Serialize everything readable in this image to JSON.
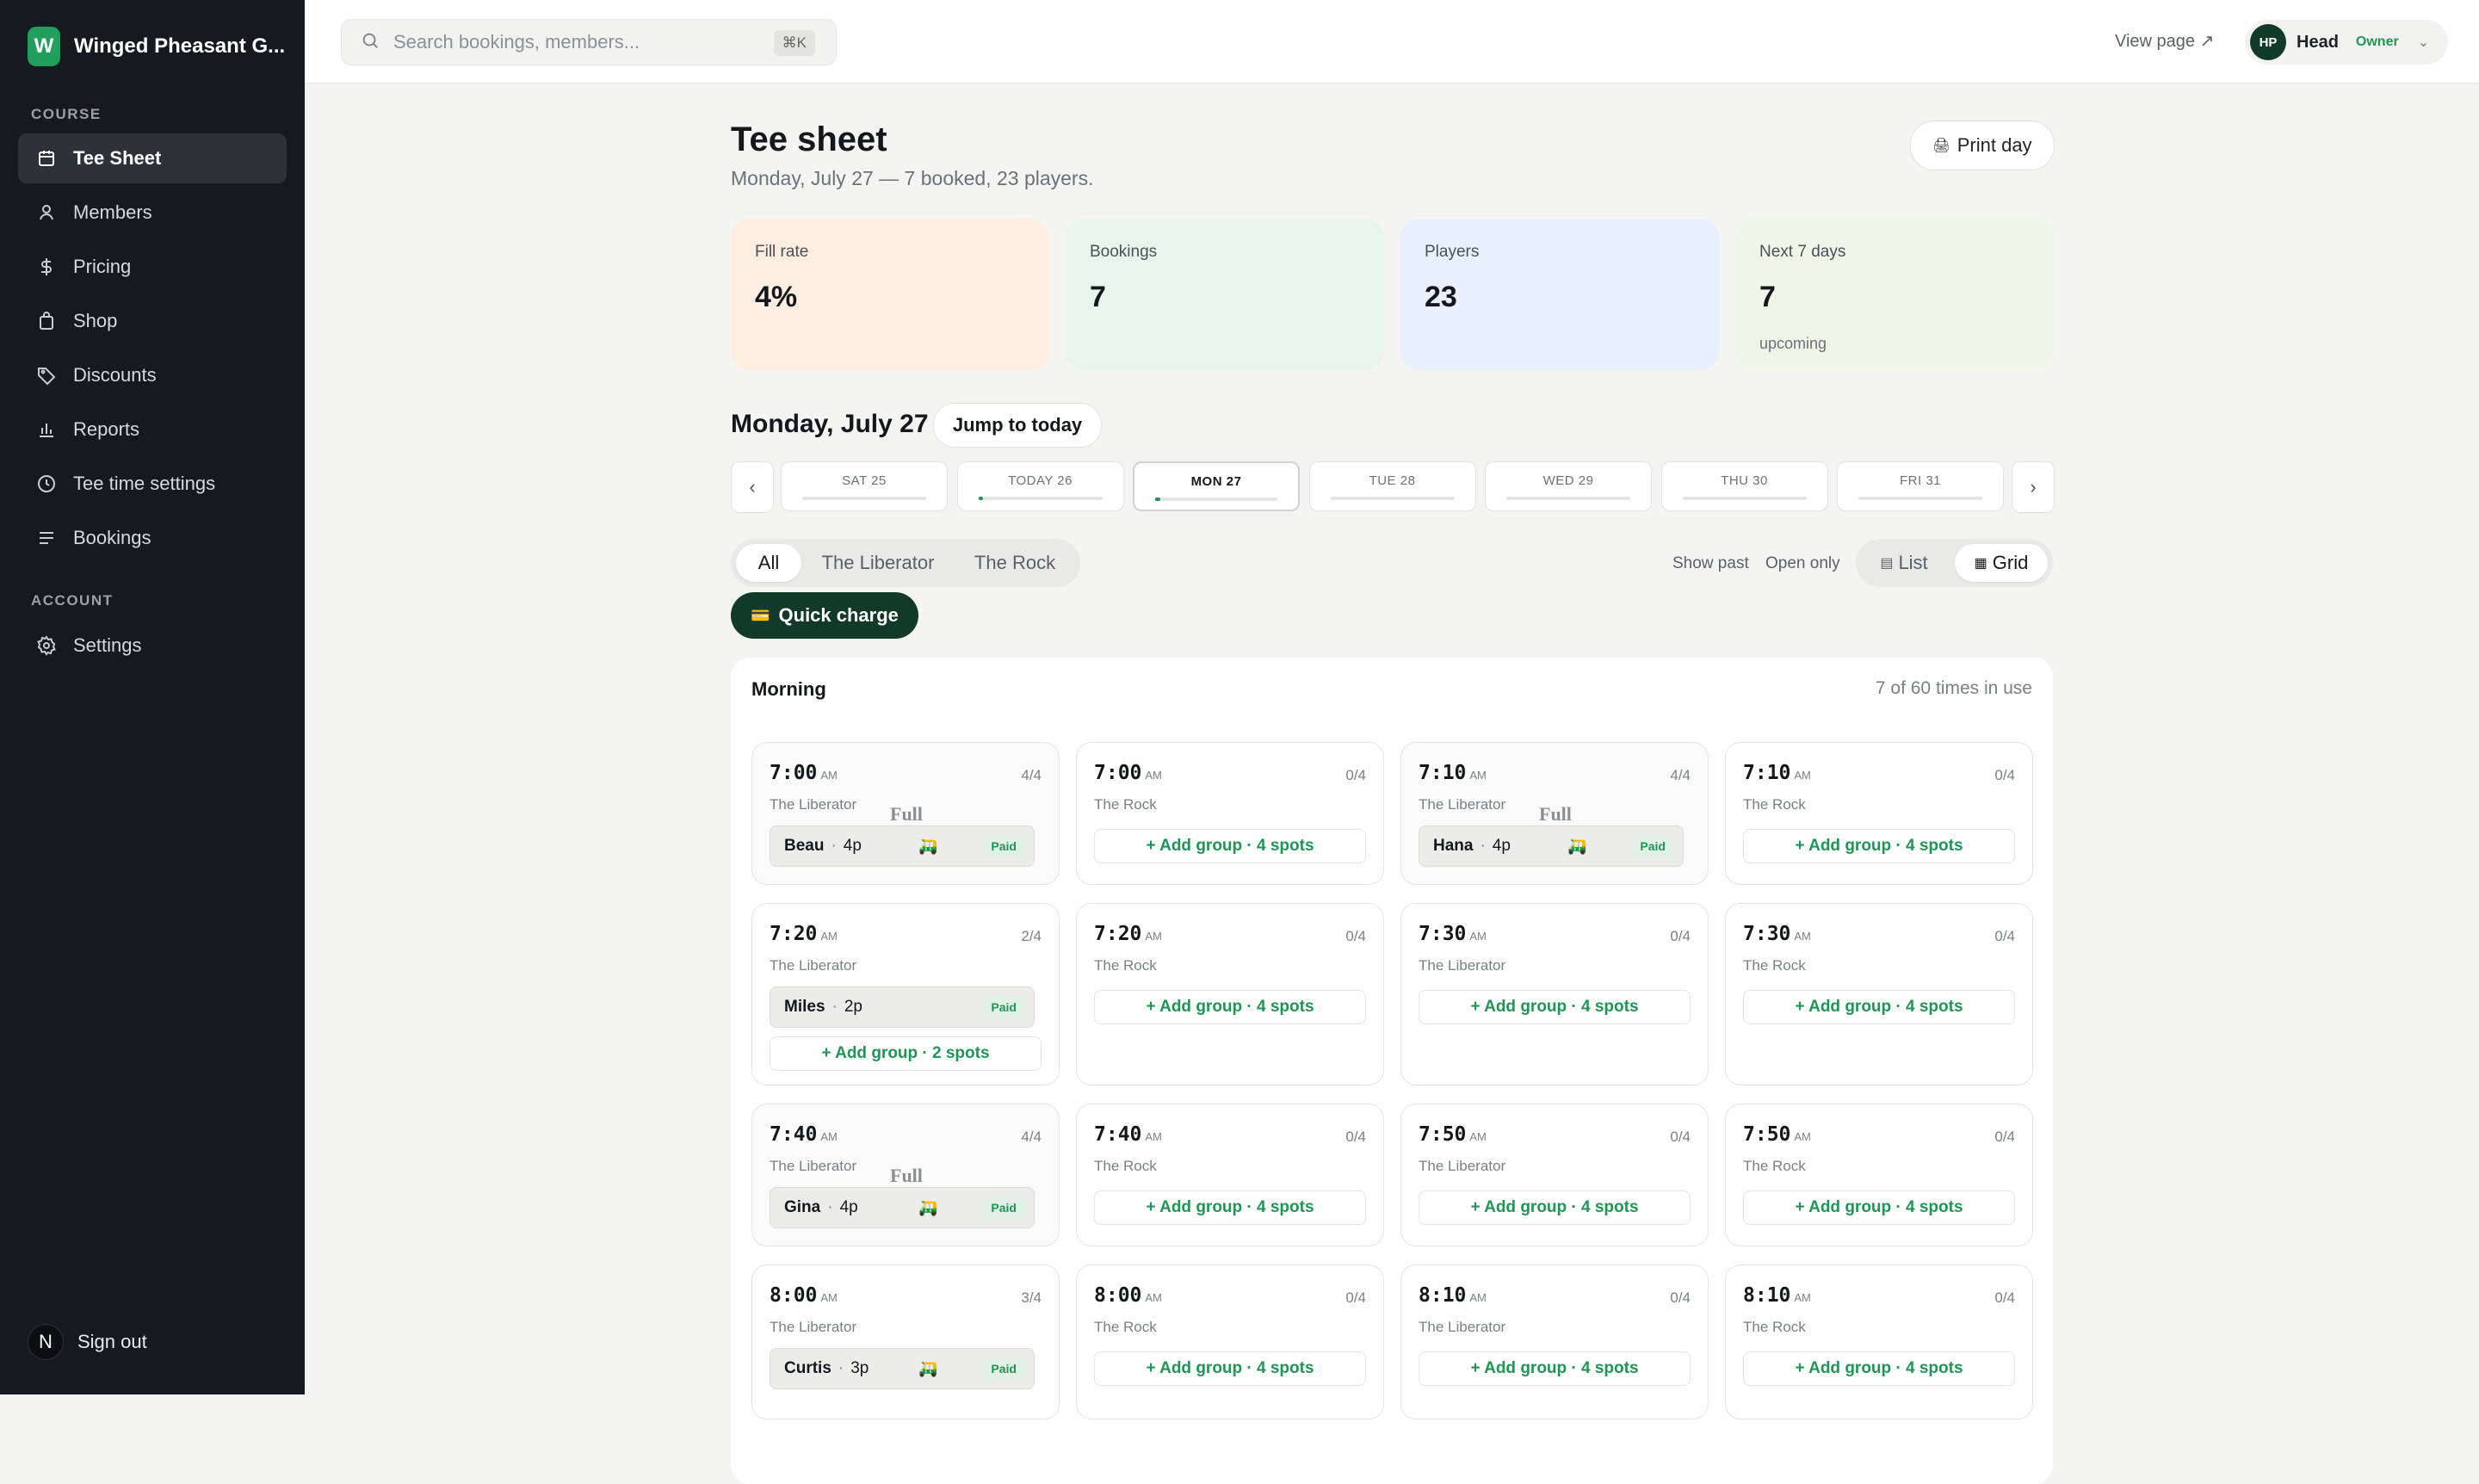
{
  "sidebar": {
    "brand_initial": "W",
    "brand_name": "Winged Pheasant G...",
    "section_course": "COURSE",
    "section_account": "ACCOUNT",
    "items": [
      {
        "label": "Tee Sheet",
        "icon": "calendar-icon"
      },
      {
        "label": "Members",
        "icon": "person-icon"
      },
      {
        "label": "Pricing",
        "icon": "dollar-icon"
      },
      {
        "label": "Shop",
        "icon": "bag-icon"
      },
      {
        "label": "Discounts",
        "icon": "tag-icon"
      },
      {
        "label": "Reports",
        "icon": "bar-chart-icon"
      },
      {
        "label": "Tee time settings",
        "icon": "clock-icon"
      },
      {
        "label": "Bookings",
        "icon": "list-icon"
      }
    ],
    "settings_label": "Settings",
    "signout_initial": "N",
    "signout_label": "Sign out"
  },
  "topbar": {
    "search_placeholder": "Search bookings, members...",
    "search_shortcut": "⌘K",
    "view_page": "View page ↗",
    "user_initials": "HP",
    "user_name": "Head",
    "user_role": "Owner"
  },
  "page": {
    "title": "Tee sheet",
    "subtitle": "Monday, July 27 — 7 booked, 23 players.",
    "print_label": "Print day",
    "stats": [
      {
        "label": "Fill rate",
        "value": "4%",
        "sub": "",
        "bg": "#fdeee2"
      },
      {
        "label": "Bookings",
        "value": "7",
        "sub": "",
        "bg": "#e8f5ec"
      },
      {
        "label": "Players",
        "value": "23",
        "sub": "",
        "bg": "#e8f0fb"
      },
      {
        "label": "Next 7 days",
        "value": "7",
        "sub": "upcoming",
        "bg": "#eef6e8"
      }
    ],
    "day_heading": "Monday, July 27",
    "jump_label": "Jump to today",
    "dates": [
      {
        "label": "SAT 25",
        "fill": 0
      },
      {
        "label": "TODAY 26",
        "fill": 0.03
      },
      {
        "label": "MON 27",
        "fill": 0.04,
        "selected": true
      },
      {
        "label": "TUE 28",
        "fill": 0
      },
      {
        "label": "WED 29",
        "fill": 0
      },
      {
        "label": "THU 30",
        "fill": 0
      },
      {
        "label": "FRI 31",
        "fill": 0
      }
    ],
    "course_tabs": [
      "All",
      "The Liberator",
      "The Rock"
    ],
    "show_past": "Show past",
    "open_only": "Open only",
    "view_list": "List",
    "view_grid": "Grid",
    "quick_charge": "Quick charge",
    "section_title": "Morning",
    "section_meta": "7 of 60 times in use",
    "full_label": "Full",
    "paid_label": "Paid",
    "slots": [
      {
        "time": "7:00",
        "ampm": "AM",
        "count": "4/4",
        "course": "The Liberator",
        "full": true,
        "booking": {
          "name": "Beau",
          "players": "4p",
          "cart": true
        },
        "add": ""
      },
      {
        "time": "7:00",
        "ampm": "AM",
        "count": "0/4",
        "course": "The Rock",
        "full": false,
        "booking": null,
        "add": "+ Add group · 4 spots"
      },
      {
        "time": "7:10",
        "ampm": "AM",
        "count": "4/4",
        "course": "The Liberator",
        "full": true,
        "booking": {
          "name": "Hana",
          "players": "4p",
          "cart": true
        },
        "add": ""
      },
      {
        "time": "7:10",
        "ampm": "AM",
        "count": "0/4",
        "course": "The Rock",
        "full": false,
        "booking": null,
        "add": "+ Add group · 4 spots"
      },
      {
        "time": "7:20",
        "ampm": "AM",
        "count": "2/4",
        "course": "The Liberator",
        "full": false,
        "booking": {
          "name": "Miles",
          "players": "2p",
          "cart": false
        },
        "add": "+ Add group · 2 spots"
      },
      {
        "time": "7:20",
        "ampm": "AM",
        "count": "0/4",
        "course": "The Rock",
        "full": false,
        "booking": null,
        "add": "+ Add group · 4 spots"
      },
      {
        "time": "7:30",
        "ampm": "AM",
        "count": "0/4",
        "course": "The Liberator",
        "full": false,
        "booking": null,
        "add": "+ Add group · 4 spots"
      },
      {
        "time": "7:30",
        "ampm": "AM",
        "count": "0/4",
        "course": "The Rock",
        "full": false,
        "booking": null,
        "add": "+ Add group · 4 spots"
      },
      {
        "time": "7:40",
        "ampm": "AM",
        "count": "4/4",
        "course": "The Liberator",
        "full": true,
        "booking": {
          "name": "Gina",
          "players": "4p",
          "cart": true
        },
        "add": ""
      },
      {
        "time": "7:40",
        "ampm": "AM",
        "count": "0/4",
        "course": "The Rock",
        "full": false,
        "booking": null,
        "add": "+ Add group · 4 spots"
      },
      {
        "time": "7:50",
        "ampm": "AM",
        "count": "0/4",
        "course": "The Liberator",
        "full": false,
        "booking": null,
        "add": "+ Add group · 4 spots"
      },
      {
        "time": "7:50",
        "ampm": "AM",
        "count": "0/4",
        "course": "The Rock",
        "full": false,
        "booking": null,
        "add": "+ Add group · 4 spots"
      },
      {
        "time": "8:00",
        "ampm": "AM",
        "count": "3/4",
        "course": "The Liberator",
        "full": false,
        "booking": {
          "name": "Curtis",
          "players": "3p",
          "cart": true
        },
        "add": ""
      },
      {
        "time": "8:00",
        "ampm": "AM",
        "count": "0/4",
        "course": "The Rock",
        "full": false,
        "booking": null,
        "add": "+ Add group · 4 spots"
      },
      {
        "time": "8:10",
        "ampm": "AM",
        "count": "0/4",
        "course": "The Liberator",
        "full": false,
        "booking": null,
        "add": "+ Add group · 4 spots"
      },
      {
        "time": "8:10",
        "ampm": "AM",
        "count": "0/4",
        "course": "The Rock",
        "full": false,
        "booking": null,
        "add": "+ Add group · 4 spots"
      }
    ]
  },
  "colors": {
    "accent": "#1f9654",
    "dark_green": "#123a2a",
    "sidebar_bg": "#141a1f"
  }
}
